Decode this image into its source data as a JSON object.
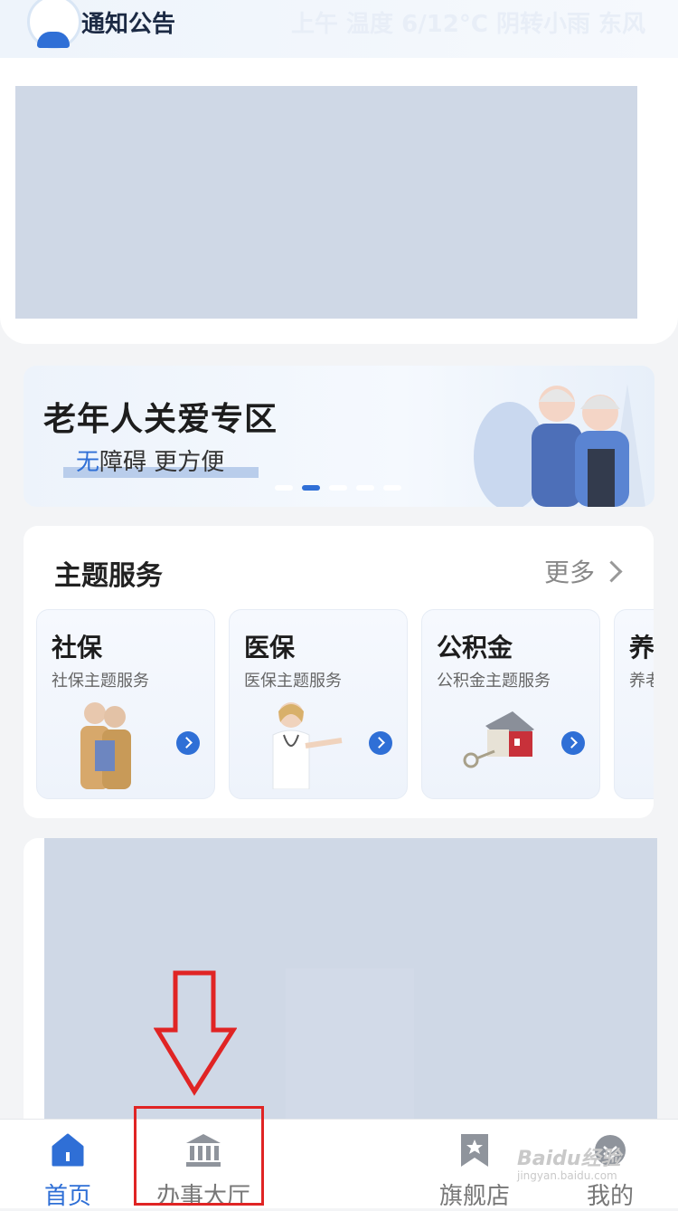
{
  "notice": {
    "title": "通知公告",
    "weather": "上午 温度 6/12°C 阴转小雨 东风"
  },
  "elderly_banner": {
    "title": "老年人关爱专区",
    "subtitle_accent": "无",
    "subtitle_rest": "障碍 更方便",
    "active_dot": 2
  },
  "theme_services": {
    "heading": "主题服务",
    "more_label": "更多",
    "cards": [
      {
        "title": "社保",
        "subtitle": "社保主题服务"
      },
      {
        "title": "医保",
        "subtitle": "医保主题服务"
      },
      {
        "title": "公积金",
        "subtitle": "公积金主题服务"
      },
      {
        "title": "养",
        "subtitle": "养老"
      }
    ]
  },
  "tabbar": {
    "items": [
      {
        "label": "首页",
        "icon": "home-icon",
        "active": true
      },
      {
        "label": "办事大厅",
        "icon": "bank-building-icon",
        "active": false
      },
      {
        "label": "旗舰店",
        "icon": "bookmark-star-icon",
        "active": false
      },
      {
        "label": "我的",
        "icon": "profile-icon",
        "active": false
      }
    ]
  },
  "watermark": {
    "text": "Baidu经验",
    "url_text": "jingyan.baidu.com"
  },
  "colors": {
    "accent": "#2f6fd6",
    "highlight": "#e02424",
    "redacted": "#cfd8e6"
  }
}
